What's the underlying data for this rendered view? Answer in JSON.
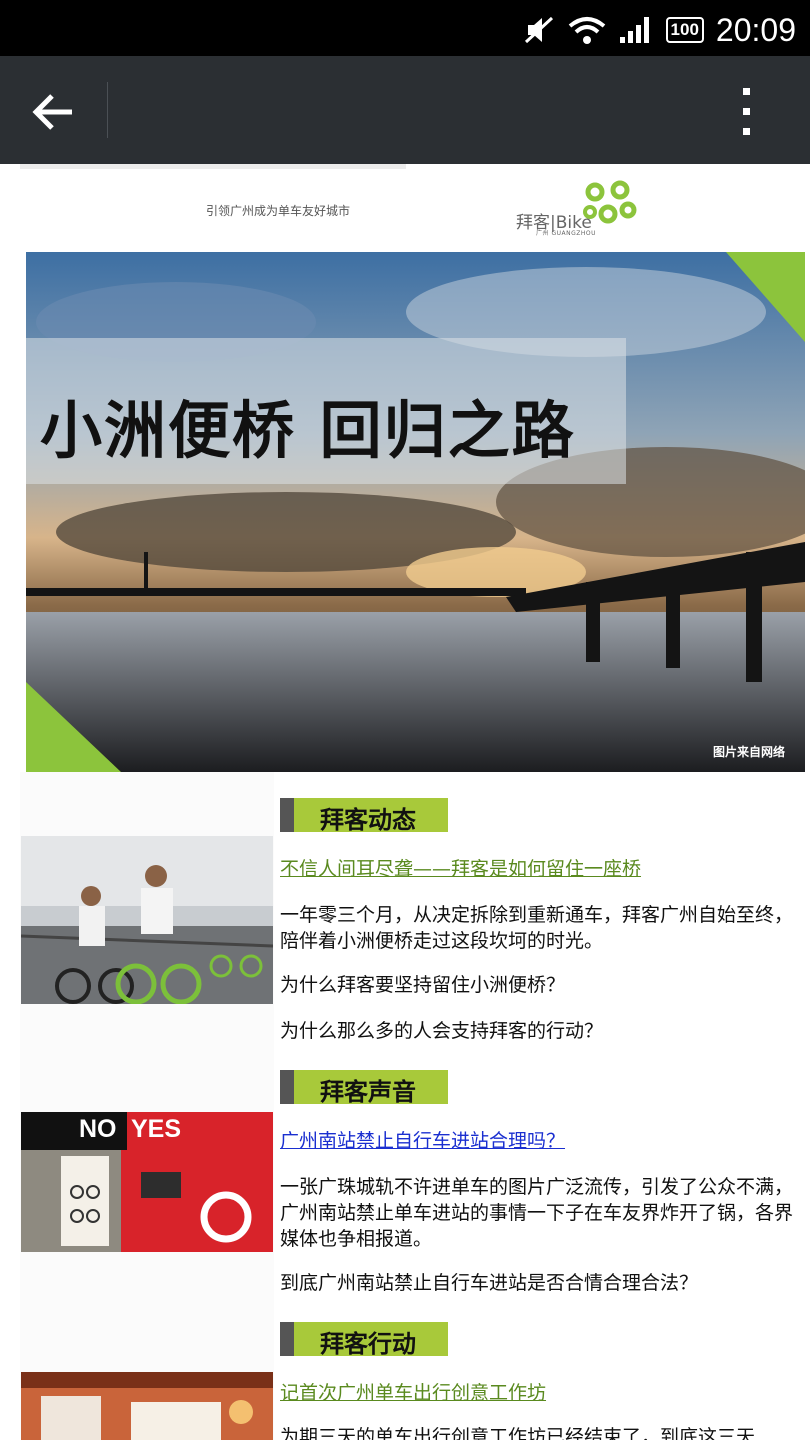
{
  "status_bar": {
    "time": "20:09",
    "battery": "100"
  },
  "header": {
    "tagline": "引领广州成为单车友好城市",
    "logo_text": "拜客|Bike",
    "logo_sub_cn": "广州",
    "logo_sub_en": "GUANGZHOU"
  },
  "banner": {
    "title": "小洲便桥 回归之路",
    "credit": "图片来自网络"
  },
  "sections": [
    {
      "header": "拜客动态",
      "link": "不信人间耳尽聋——拜客是如何留住一座桥",
      "paragraphs": [
        "一年零三个月，从决定拆除到重新通车，拜客广州自始至终，陪伴着小洲便桥走过这段坎坷的时光。",
        "为什么拜客要坚持留住小洲便桥？",
        "为什么那么多的人会支持拜客的行动？"
      ]
    },
    {
      "header": "拜客声音",
      "link": "广州南站禁止自行车进站合理吗？",
      "thumb_no": "NO",
      "thumb_yes": "YES",
      "paragraphs": [
        "一张广珠城轨不许进单车的图片广泛流传，引发了公众不满，广州南站禁止单车进站的事情一下子在车友界炸开了锅，各界媒体也争相报道。",
        "到底广州南站禁止自行车进站是否合情合理合法？"
      ]
    },
    {
      "header": "拜客行动",
      "link": "记首次广州单车出行创意工作坊",
      "paragraphs": [
        "为期三天的单车出行创意工作坊已经结束了，到底这三天"
      ]
    }
  ],
  "colors": {
    "accent_green": "#a8c93a",
    "link_green": "#5a8a1f",
    "link_blue": "#1a2fd0",
    "appbar": "#2b2f33"
  }
}
